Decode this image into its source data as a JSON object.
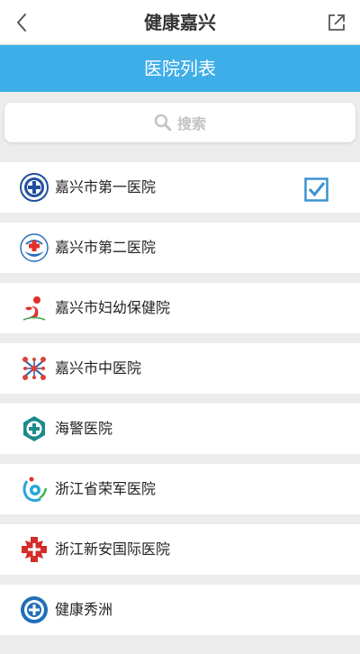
{
  "header": {
    "title": "健康嘉兴",
    "back_icon": "chevron-left-icon",
    "share_icon": "share-external-icon"
  },
  "banner": {
    "title": "医院列表",
    "color": "#3eaee8"
  },
  "search": {
    "placeholder": "搜索",
    "icon": "search-icon"
  },
  "hospitals": [
    {
      "name": "嘉兴市第一医院",
      "selected": true,
      "logo_icon": "hospital-1-logo-icon"
    },
    {
      "name": "嘉兴市第二医院",
      "selected": false,
      "logo_icon": "hospital-2-logo-icon"
    },
    {
      "name": "嘉兴市妇幼保健院",
      "selected": false,
      "logo_icon": "maternal-child-logo-icon"
    },
    {
      "name": "嘉兴市中医院",
      "selected": false,
      "logo_icon": "tcm-hospital-logo-icon"
    },
    {
      "name": "海警医院",
      "selected": false,
      "logo_icon": "coast-guard-hospital-logo-icon"
    },
    {
      "name": "浙江省荣军医院",
      "selected": false,
      "logo_icon": "veterans-hospital-logo-icon"
    },
    {
      "name": "浙江新安国际医院",
      "selected": false,
      "logo_icon": "xinan-hospital-logo-icon"
    },
    {
      "name": "健康秀洲",
      "selected": false,
      "logo_icon": "health-xiuzhou-logo-icon"
    }
  ],
  "colors": {
    "accent": "#3eaee8",
    "check": "#3b93d0"
  }
}
